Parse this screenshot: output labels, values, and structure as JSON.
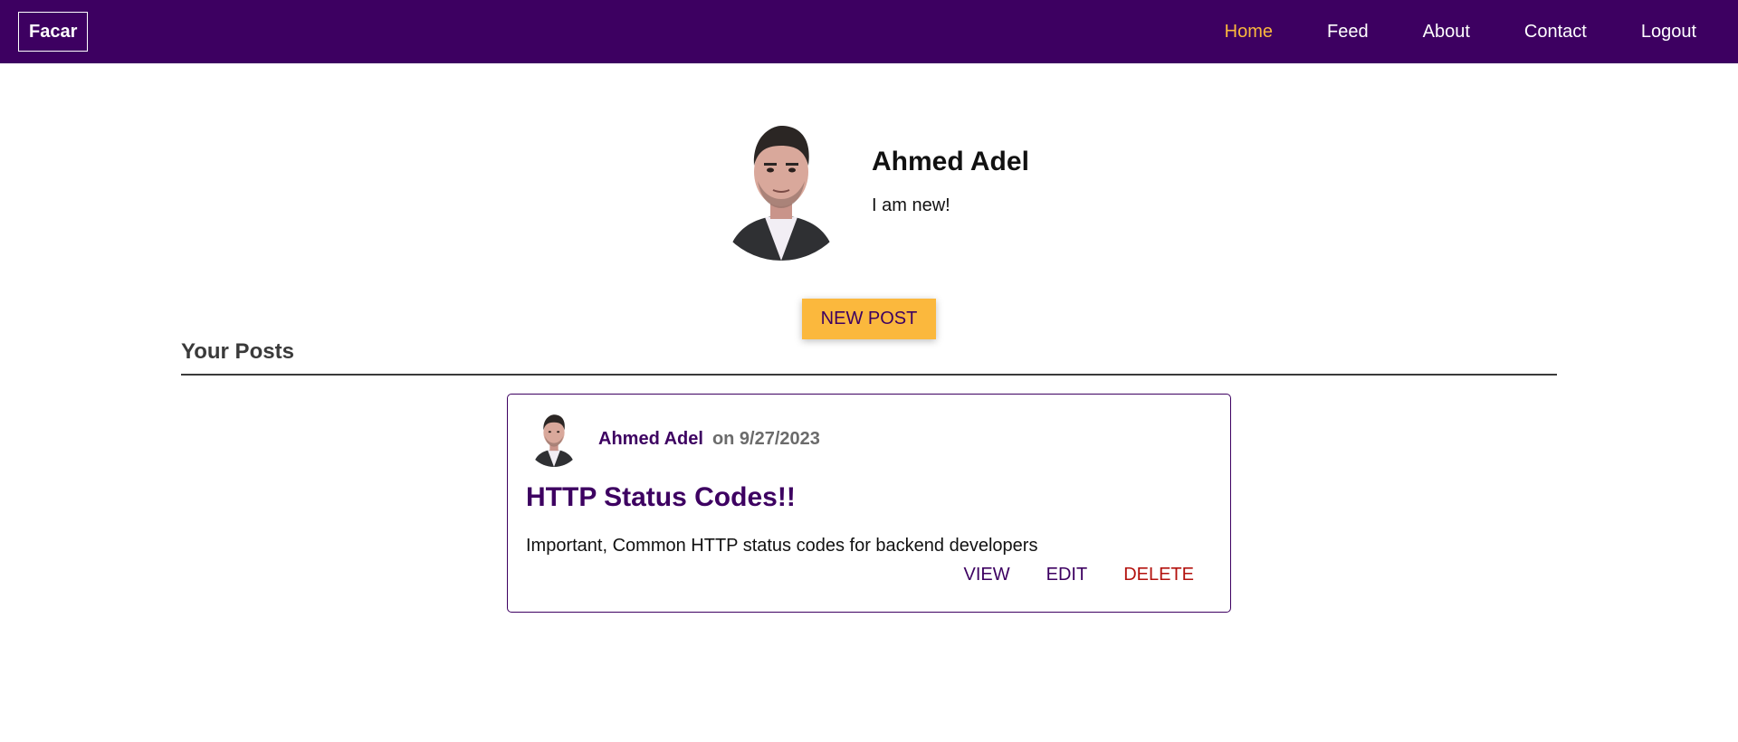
{
  "navbar": {
    "logo": "Facar",
    "links": [
      {
        "label": "Home",
        "active": true
      },
      {
        "label": "Feed",
        "active": false
      },
      {
        "label": "About",
        "active": false
      },
      {
        "label": "Contact",
        "active": false
      },
      {
        "label": "Logout",
        "active": false
      }
    ]
  },
  "profile": {
    "name": "Ahmed Adel",
    "bio": "I am new!"
  },
  "new_post_label": "NEW POST",
  "posts_section": {
    "title": "Your Posts",
    "posts": [
      {
        "author": "Ahmed Adel",
        "date": "on 9/27/2023",
        "title": "HTTP Status Codes!!",
        "excerpt": "Important, Common HTTP status codes for backend developers",
        "actions": {
          "view": "VIEW",
          "edit": "EDIT",
          "delete": "DELETE"
        }
      }
    ]
  },
  "colors": {
    "brand": "#3d0061",
    "accent": "#fbb83d",
    "danger": "#b3120e"
  }
}
